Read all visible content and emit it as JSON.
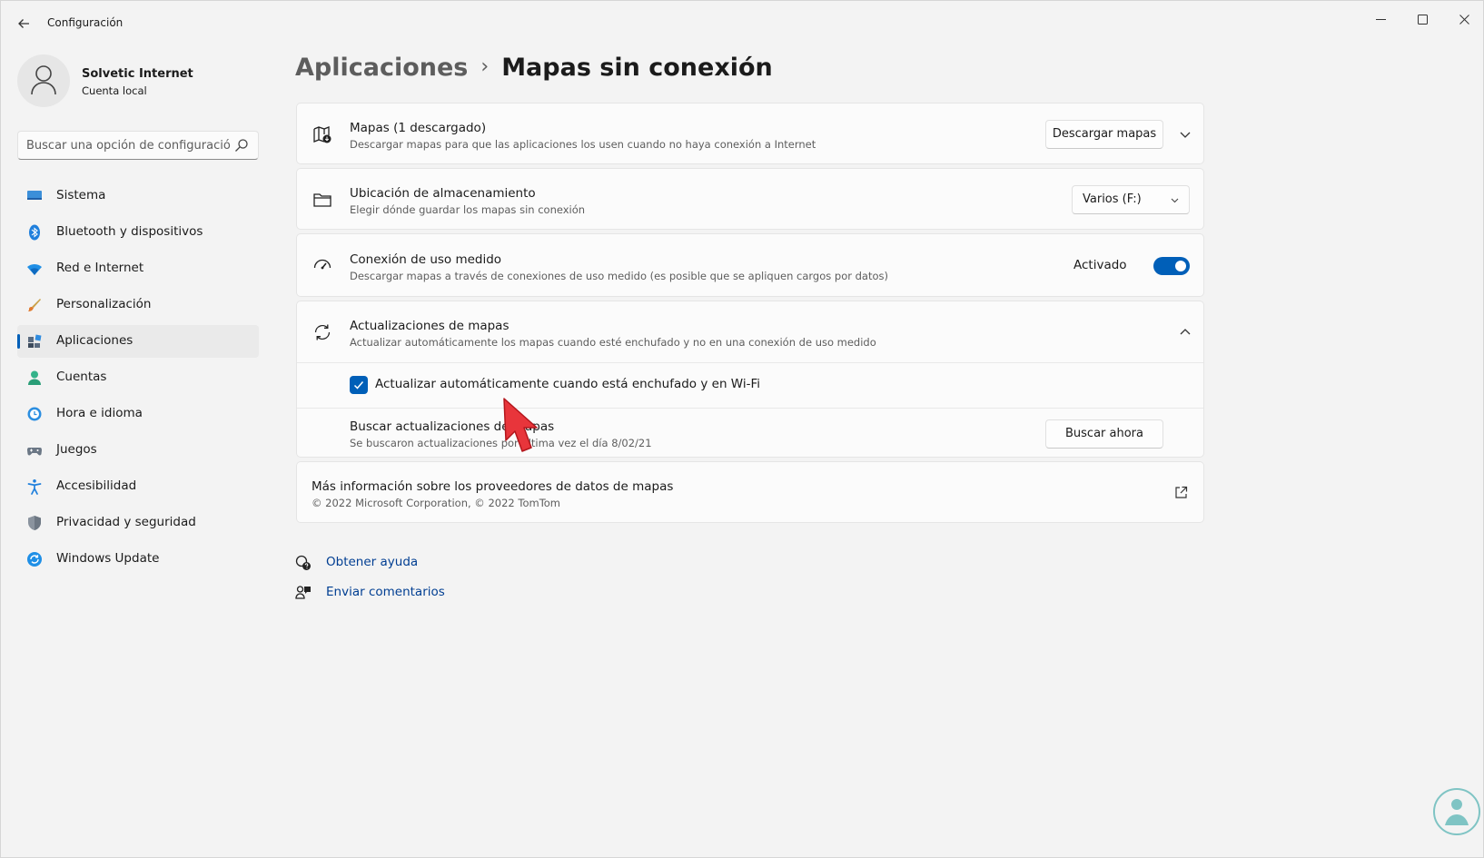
{
  "window": {
    "title": "Configuración",
    "controls": {
      "minimize": "–",
      "maximize": "☐",
      "close": "✕"
    }
  },
  "profile": {
    "name": "Solvetic Internet",
    "account_type": "Cuenta local"
  },
  "search": {
    "placeholder": "Buscar una opción de configuración",
    "icon": "search-icon"
  },
  "sidebar": {
    "items": [
      {
        "label": "Sistema",
        "icon": "monitor-icon",
        "selected": false
      },
      {
        "label": "Bluetooth y dispositivos",
        "icon": "bluetooth-icon",
        "selected": false
      },
      {
        "label": "Red e Internet",
        "icon": "wifi-icon",
        "selected": false
      },
      {
        "label": "Personalización",
        "icon": "brush-icon",
        "selected": false
      },
      {
        "label": "Aplicaciones",
        "icon": "apps-icon",
        "selected": true
      },
      {
        "label": "Cuentas",
        "icon": "person-icon",
        "selected": false
      },
      {
        "label": "Hora e idioma",
        "icon": "clock-globe-icon",
        "selected": false
      },
      {
        "label": "Juegos",
        "icon": "gamepad-icon",
        "selected": false
      },
      {
        "label": "Accesibilidad",
        "icon": "accessibility-icon",
        "selected": false
      },
      {
        "label": "Privacidad y seguridad",
        "icon": "shield-icon",
        "selected": false
      },
      {
        "label": "Windows Update",
        "icon": "update-icon",
        "selected": false
      }
    ]
  },
  "breadcrumb": {
    "parent": "Aplicaciones",
    "separator": "›",
    "current": "Mapas sin conexión"
  },
  "cards": {
    "maps": {
      "title": "Mapas (1 descargado)",
      "description": "Descargar mapas para que las aplicaciones los usen cuando no haya conexión a Internet",
      "button": "Descargar mapas"
    },
    "storage": {
      "title": "Ubicación de almacenamiento",
      "description": "Elegir dónde guardar los mapas sin conexión",
      "selected_value": "Varios (F:)"
    },
    "metered": {
      "title": "Conexión de uso medido",
      "description": "Descargar mapas a través de conexiones de uso medido (es posible que se apliquen cargos por datos)",
      "toggle_state": "Activado",
      "toggle_on": true
    },
    "updates": {
      "title": "Actualizaciones de mapas",
      "description": "Actualizar automáticamente los mapas cuando esté enchufado y no en una conexión de uso medido",
      "auto_update_label": "Actualizar automáticamente cuando está enchufado y en Wi-Fi",
      "auto_update_checked": true,
      "check_title": "Buscar actualizaciones de mapas",
      "check_desc": "Se buscaron actualizaciones por última vez el día 8/02/21",
      "check_button": "Buscar ahora"
    },
    "providers": {
      "title": "Más información sobre los proveedores de datos de mapas",
      "description": "© 2022 Microsoft Corporation, © 2022 TomTom"
    }
  },
  "help": {
    "get_help": "Obtener ayuda",
    "feedback": "Enviar comentarios"
  },
  "colors": {
    "accent": "#005fb8",
    "link": "#003e92",
    "cursor": "#e8353b"
  }
}
